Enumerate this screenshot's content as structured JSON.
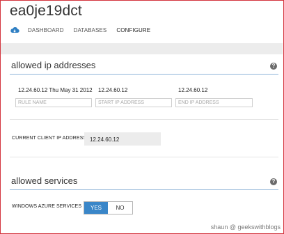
{
  "page": {
    "title": "ea0je19dct"
  },
  "nav": {
    "icon": "cloud-sql-icon",
    "items": [
      {
        "label": "DASHBOARD"
      },
      {
        "label": "DATABASES"
      },
      {
        "label": "CONFIGURE",
        "active": true
      }
    ]
  },
  "allowed_ip": {
    "title": "allowed ip addresses",
    "help_icon": "question-icon",
    "help_glyph": "?",
    "existing_rule": {
      "name": "12.24.60.12 Thu May 31 2012",
      "start_ip": "12.24.60.12",
      "end_ip": "12.24.60.12"
    },
    "placeholders": {
      "rule_name": "RULE NAME",
      "start_ip": "START IP ADDRESS",
      "end_ip": "END IP ADDRESS"
    }
  },
  "client_ip": {
    "label": "CURRENT CLIENT IP ADDRESS",
    "value": "12.24.60.12"
  },
  "allowed_services": {
    "title": "allowed services",
    "help_icon": "question-icon",
    "help_glyph": "?",
    "label": "WINDOWS AZURE SERVICES",
    "yes_label": "YES",
    "no_label": "NO",
    "selected": "YES"
  },
  "watermark": "shaun @ geekswithblogs",
  "colors": {
    "accent": "#3a86c8",
    "border": "#d3343d",
    "divider": "#8fb5d8"
  }
}
